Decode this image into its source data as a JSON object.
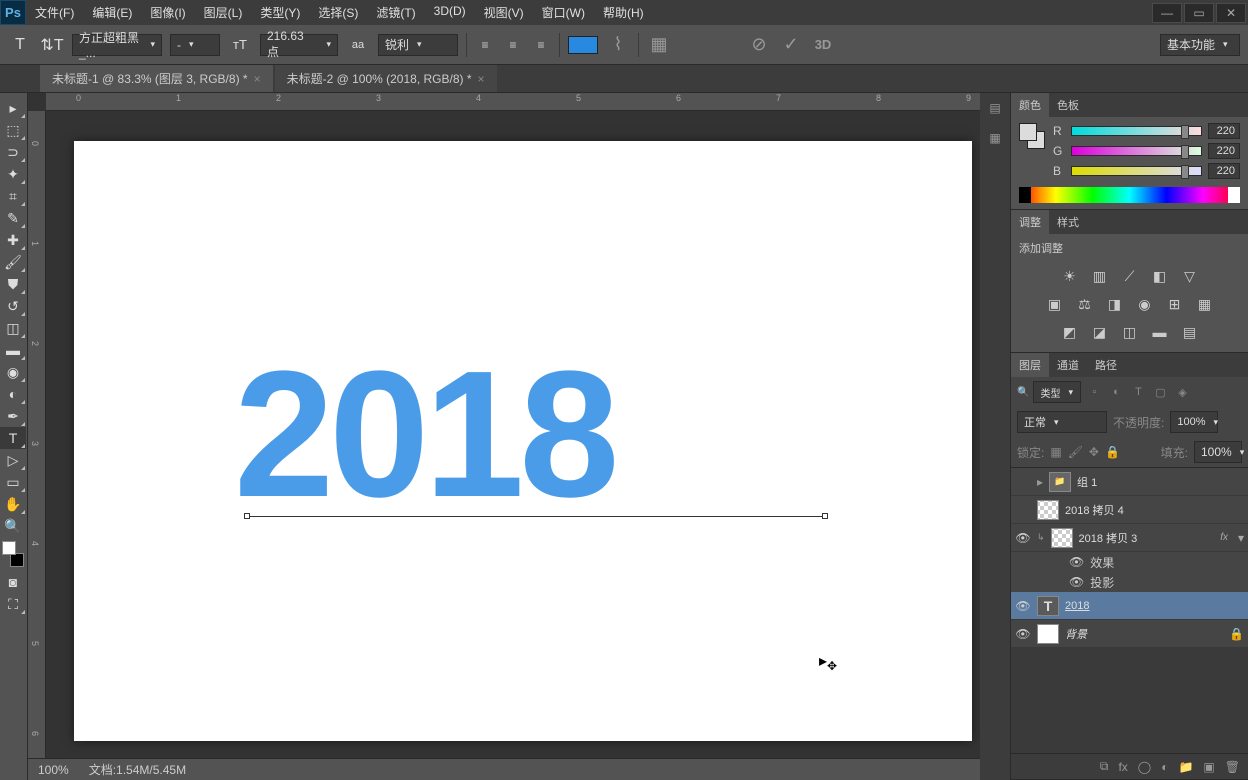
{
  "app": {
    "logo": "Ps"
  },
  "menu": [
    "文件(F)",
    "编辑(E)",
    "图像(I)",
    "图层(L)",
    "类型(Y)",
    "选择(S)",
    "滤镜(T)",
    "3D(D)",
    "视图(V)",
    "窗口(W)",
    "帮助(H)"
  ],
  "options": {
    "font_family": "方正超粗黑_...",
    "font_style": "-",
    "font_size": "216.63 点",
    "aa_label": "aa",
    "anti_alias": "锐利",
    "btn_3d": "3D",
    "workspace": "基本功能"
  },
  "tabs": [
    {
      "label": "未标题-1 @ 83.3% (图层 3, RGB/8) *",
      "active": false
    },
    {
      "label": "未标题-2 @ 100% (2018, RGB/8) *",
      "active": true
    }
  ],
  "canvas": {
    "text": "2018",
    "ruler_h": [
      "0",
      "1",
      "2",
      "3",
      "4",
      "5",
      "6",
      "7",
      "8",
      "9"
    ],
    "ruler_v": [
      "0",
      "1",
      "2",
      "3",
      "4",
      "5",
      "6"
    ]
  },
  "status": {
    "zoom": "100%",
    "doc": "文档:1.54M/5.45M"
  },
  "color_panel": {
    "tabs": [
      "颜色",
      "色板"
    ],
    "sliders": [
      {
        "label": "R",
        "val": "220",
        "grad": "linear-gradient(to right,#00dcdc,#ffdcdc)"
      },
      {
        "label": "G",
        "val": "220",
        "grad": "linear-gradient(to right,#dc00dc,#dcffdc)"
      },
      {
        "label": "B",
        "val": "220",
        "grad": "linear-gradient(to right,#dcdc00,#dcdcff)"
      }
    ]
  },
  "adjust_panel": {
    "tabs": [
      "调整",
      "样式"
    ],
    "title": "添加调整"
  },
  "layers_panel": {
    "tabs": [
      "图层",
      "通道",
      "路径"
    ],
    "filter_label": "类型",
    "blend_mode": "正常",
    "opacity_label": "不透明度:",
    "opacity_val": "100%",
    "lock_label": "锁定:",
    "fill_label": "填充:",
    "fill_val": "100%",
    "layers": [
      {
        "vis": "",
        "name": "组 1",
        "type": "group"
      },
      {
        "vis": "",
        "name": "2018 拷贝 4",
        "type": "checker"
      },
      {
        "vis": "👁",
        "name": "2018 拷贝 3",
        "type": "checker",
        "fx": "fx"
      },
      {
        "vis": "👁",
        "name": "2018",
        "type": "text",
        "selected": true
      },
      {
        "vis": "👁",
        "name": "背景",
        "type": "white",
        "lock": true
      }
    ],
    "effects_label": "效果",
    "shadow_label": "投影"
  }
}
